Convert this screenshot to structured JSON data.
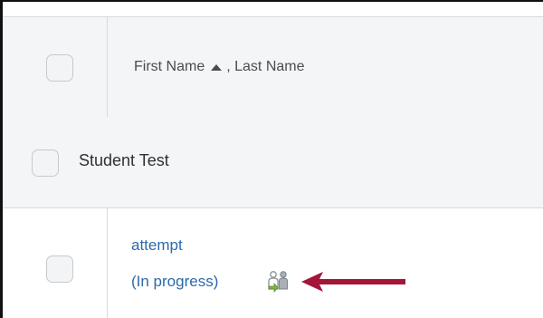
{
  "table": {
    "header": {
      "first_name_label": "First Name",
      "last_name_label": ", Last Name",
      "sort_direction": "ascending"
    },
    "group_row": {
      "label": "Student Test"
    },
    "data_row": {
      "link_label": "attempt",
      "status_label": "(In progress)",
      "status_icon": "users-icon"
    }
  },
  "colors": {
    "link": "#2c6aa8",
    "arrow": "#a3163a",
    "header_bg": "#f4f5f6",
    "border": "#d9dadc"
  }
}
